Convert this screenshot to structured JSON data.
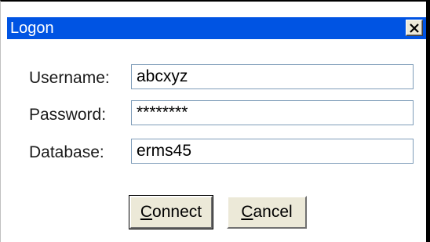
{
  "window": {
    "title": "Logon",
    "close_icon": "close-icon"
  },
  "form": {
    "username": {
      "label": "Username:",
      "value": "abcxyz"
    },
    "password": {
      "label": "Password:",
      "value": "********"
    },
    "database": {
      "label": "Database:",
      "value": "erms45"
    }
  },
  "buttons": {
    "connect": {
      "access_key": "C",
      "rest": "onnect"
    },
    "cancel": {
      "access_key": "C",
      "rest": "ancel"
    }
  },
  "colors": {
    "titlebar": "#0054e3",
    "button_face": "#ece9d8",
    "field_border": "#7f9db9"
  }
}
